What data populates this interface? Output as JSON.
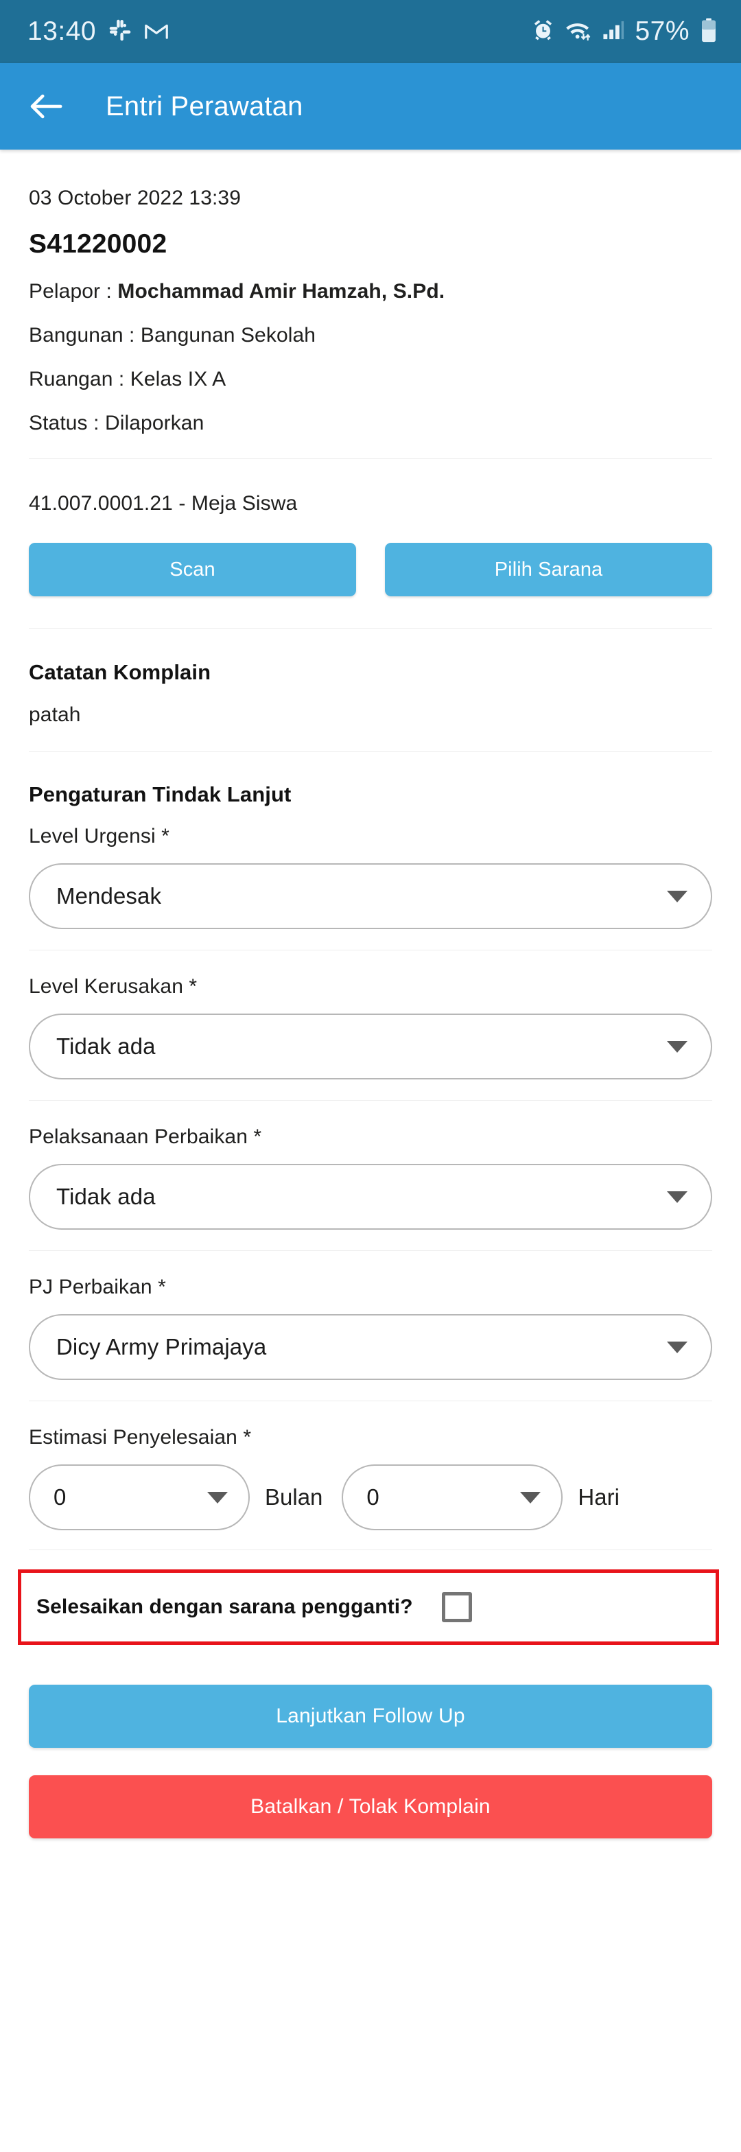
{
  "statusbar": {
    "clock": "13:40",
    "battery_percent": "57%",
    "icons": [
      "slack-icon",
      "gmail-icon",
      "alarm-icon",
      "wifi-icon",
      "signal-icon",
      "battery-icon"
    ]
  },
  "appbar": {
    "back_icon": "back-arrow-icon",
    "title": "Entri Perawatan"
  },
  "report": {
    "timestamp": "03 October 2022 13:39",
    "code": "S41220002",
    "pelapor_label": "Pelapor : ",
    "pelapor_value": "Mochammad Amir Hamzah, S.Pd.",
    "bangunan": "Bangunan : Bangunan Sekolah",
    "ruangan": "Ruangan : Kelas IX A",
    "status": "Status : Dilaporkan"
  },
  "asset": {
    "name": "41.007.0001.21 - Meja Siswa",
    "scan_button": "Scan",
    "pick_button": "Pilih Sarana"
  },
  "complaint": {
    "section_title": "Catatan Komplain",
    "note": "patah"
  },
  "followup": {
    "section_title": "Pengaturan Tindak Lanjut",
    "fields": [
      {
        "label": "Level Urgensi *",
        "value": "Mendesak"
      },
      {
        "label": "Level Kerusakan *",
        "value": "Tidak ada"
      },
      {
        "label": "Pelaksanaan Perbaikan *",
        "value": "Tidak ada"
      },
      {
        "label": "PJ Perbaikan *",
        "value": "Dicy Army Primajaya"
      }
    ],
    "estimation": {
      "label": "Estimasi Penyelesaian *",
      "months_value": "0",
      "months_unit": "Bulan",
      "days_value": "0",
      "days_unit": "Hari"
    },
    "replacement": {
      "label": "Selesaikan dengan sarana pengganti?",
      "checked": false
    }
  },
  "actions": {
    "continue": "Lanjutkan Follow Up",
    "cancel": "Batalkan / Tolak Komplain"
  },
  "colors": {
    "statusbar": "#1f6f96",
    "appbar": "#2b93d4",
    "button_blue": "#4fb3e0",
    "button_red": "#fb5050",
    "highlight_red": "#e8131a"
  }
}
